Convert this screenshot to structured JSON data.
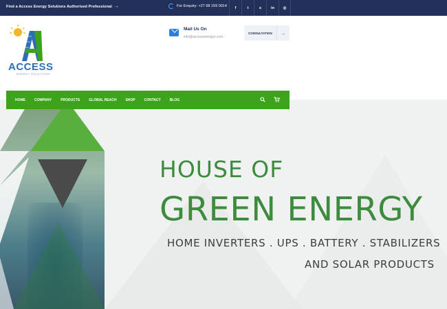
{
  "topbar": {
    "promo_text": "Find a Access Energy Solutions Authorised Professional",
    "promo_arrow": "→",
    "phone_text": "For Enquiry: +27 68 159 0014",
    "socials": [
      {
        "icon": "facebook-icon",
        "glyph": "f"
      },
      {
        "icon": "twitter-icon",
        "glyph": "t"
      },
      {
        "icon": "skype-icon",
        "glyph": "s"
      },
      {
        "icon": "linkedin-icon",
        "glyph": "in"
      },
      {
        "icon": "instagram-icon",
        "glyph": "◎"
      }
    ]
  },
  "header": {
    "logo_brand": "ACCESS",
    "logo_tag": "ENERGY SOLUTIONS",
    "mail_title": "Mail Us On",
    "mail_address": "info@accessenergys.com",
    "consult_label": "CONSULTATION",
    "consult_arrow": "→"
  },
  "nav": {
    "items": [
      "HOME",
      "COMPANY",
      "PRODUCTS",
      "GLOBAL REACH",
      "SHOP",
      "CONTACT",
      "BLOG"
    ],
    "search_glyph": "⚲",
    "cart_glyph": "🛒"
  },
  "hero": {
    "line1": "HOUSE OF",
    "line2": "GREEN ENERGY",
    "sub1": "HOME INVERTERS . UPS . BATTERY . STABILIZERS",
    "sub2": "AND SOLAR PRODUCTS"
  },
  "colors": {
    "topbar": "#22305a",
    "nav": "#3da31c",
    "headline": "#3d8b3d",
    "brand_blue": "#2d6fb5"
  }
}
